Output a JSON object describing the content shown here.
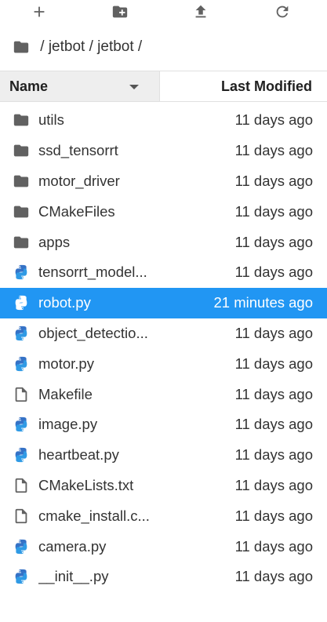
{
  "toolbar": {
    "buttons": [
      {
        "name": "new-launcher-button",
        "icon": "plus-icon"
      },
      {
        "name": "new-folder-button",
        "icon": "folder-plus-icon"
      },
      {
        "name": "upload-button",
        "icon": "upload-icon"
      },
      {
        "name": "refresh-button",
        "icon": "refresh-icon"
      }
    ]
  },
  "breadcrumb": {
    "icon": "folder-icon",
    "text": " / jetbot / jetbot / "
  },
  "header": {
    "name_label": "Name",
    "modified_label": "Last Modified"
  },
  "files": [
    {
      "name": "utils",
      "type": "folder",
      "modified": "11 days ago"
    },
    {
      "name": "ssd_tensorrt",
      "type": "folder",
      "modified": "11 days ago"
    },
    {
      "name": "motor_driver",
      "type": "folder",
      "modified": "11 days ago"
    },
    {
      "name": "CMakeFiles",
      "type": "folder",
      "modified": "11 days ago"
    },
    {
      "name": "apps",
      "type": "folder",
      "modified": "11 days ago"
    },
    {
      "name": "tensorrt_model...",
      "type": "python",
      "modified": "11 days ago"
    },
    {
      "name": "robot.py",
      "type": "python",
      "modified": "21 minutes ago",
      "selected": true
    },
    {
      "name": "object_detectio...",
      "type": "python",
      "modified": "11 days ago"
    },
    {
      "name": "motor.py",
      "type": "python",
      "modified": "11 days ago"
    },
    {
      "name": "Makefile",
      "type": "file",
      "modified": "11 days ago"
    },
    {
      "name": "image.py",
      "type": "python",
      "modified": "11 days ago"
    },
    {
      "name": "heartbeat.py",
      "type": "python",
      "modified": "11 days ago"
    },
    {
      "name": "CMakeLists.txt",
      "type": "file",
      "modified": "11 days ago"
    },
    {
      "name": "cmake_install.c...",
      "type": "file",
      "modified": "11 days ago"
    },
    {
      "name": "camera.py",
      "type": "python",
      "modified": "11 days ago"
    },
    {
      "name": "__init__.py",
      "type": "python",
      "modified": "11 days ago"
    }
  ],
  "colors": {
    "selection": "#2196f3",
    "folder_icon": "#616161",
    "python_blue": "#2f80d1",
    "icon_gray": "#616161"
  }
}
